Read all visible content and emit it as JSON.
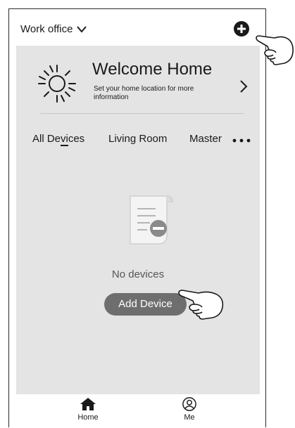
{
  "header": {
    "location": "Work office",
    "icons": {
      "dropdown": "chevron-down-icon",
      "add": "plus-circle-icon"
    }
  },
  "welcome": {
    "title": "Welcome Home",
    "subtitle": "Set your home location for more information",
    "icons": {
      "sun": "sun-icon",
      "arrow": "chevron-right-icon"
    }
  },
  "tabs": [
    {
      "label": "All Devices",
      "active": true
    },
    {
      "label": "Living Room",
      "active": false
    },
    {
      "label": "Master",
      "active": false
    }
  ],
  "empty_state": {
    "message": "No devices",
    "button_label": "Add Device",
    "icon": "document-remove-icon"
  },
  "tabbar": {
    "items": [
      {
        "label": "Home",
        "icon": "home-icon"
      },
      {
        "label": "Me",
        "icon": "user-icon"
      }
    ]
  },
  "colors": {
    "panel": "#e4e4e4",
    "button": "#6e6e6e",
    "text": "#1a1a1a"
  }
}
